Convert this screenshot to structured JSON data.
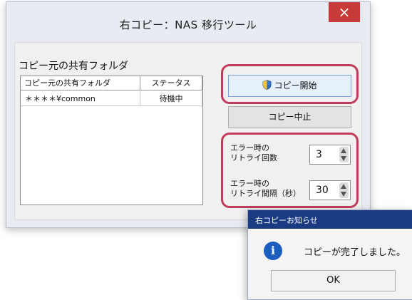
{
  "window": {
    "title": "右コピー：NAS 移行ツール",
    "close_icon": "×"
  },
  "folder_list": {
    "caption": "コピー元の共有フォルダ",
    "columns": [
      "コピー元の共有フォルダ",
      "ステータス"
    ],
    "rows": [
      {
        "folder": "＊＊＊＊¥common",
        "status": "待機中"
      }
    ]
  },
  "buttons": {
    "start_label": "コピー開始",
    "stop_label": "コピー中止"
  },
  "retry": {
    "count_label_1": "エラー時の",
    "count_label_2": "リトライ回数",
    "count_value": "3",
    "interval_label_1": "エラー時の",
    "interval_label_2": "リトライ間隔（秒）",
    "interval_value": "30"
  },
  "notice": {
    "title": "右コピーお知らせ",
    "message": "コピーが完了しました。",
    "ok_label": "OK"
  },
  "colors": {
    "highlight": "#c03c5c",
    "dialog_title": "#1a3a82",
    "close": "#c63a3a"
  }
}
